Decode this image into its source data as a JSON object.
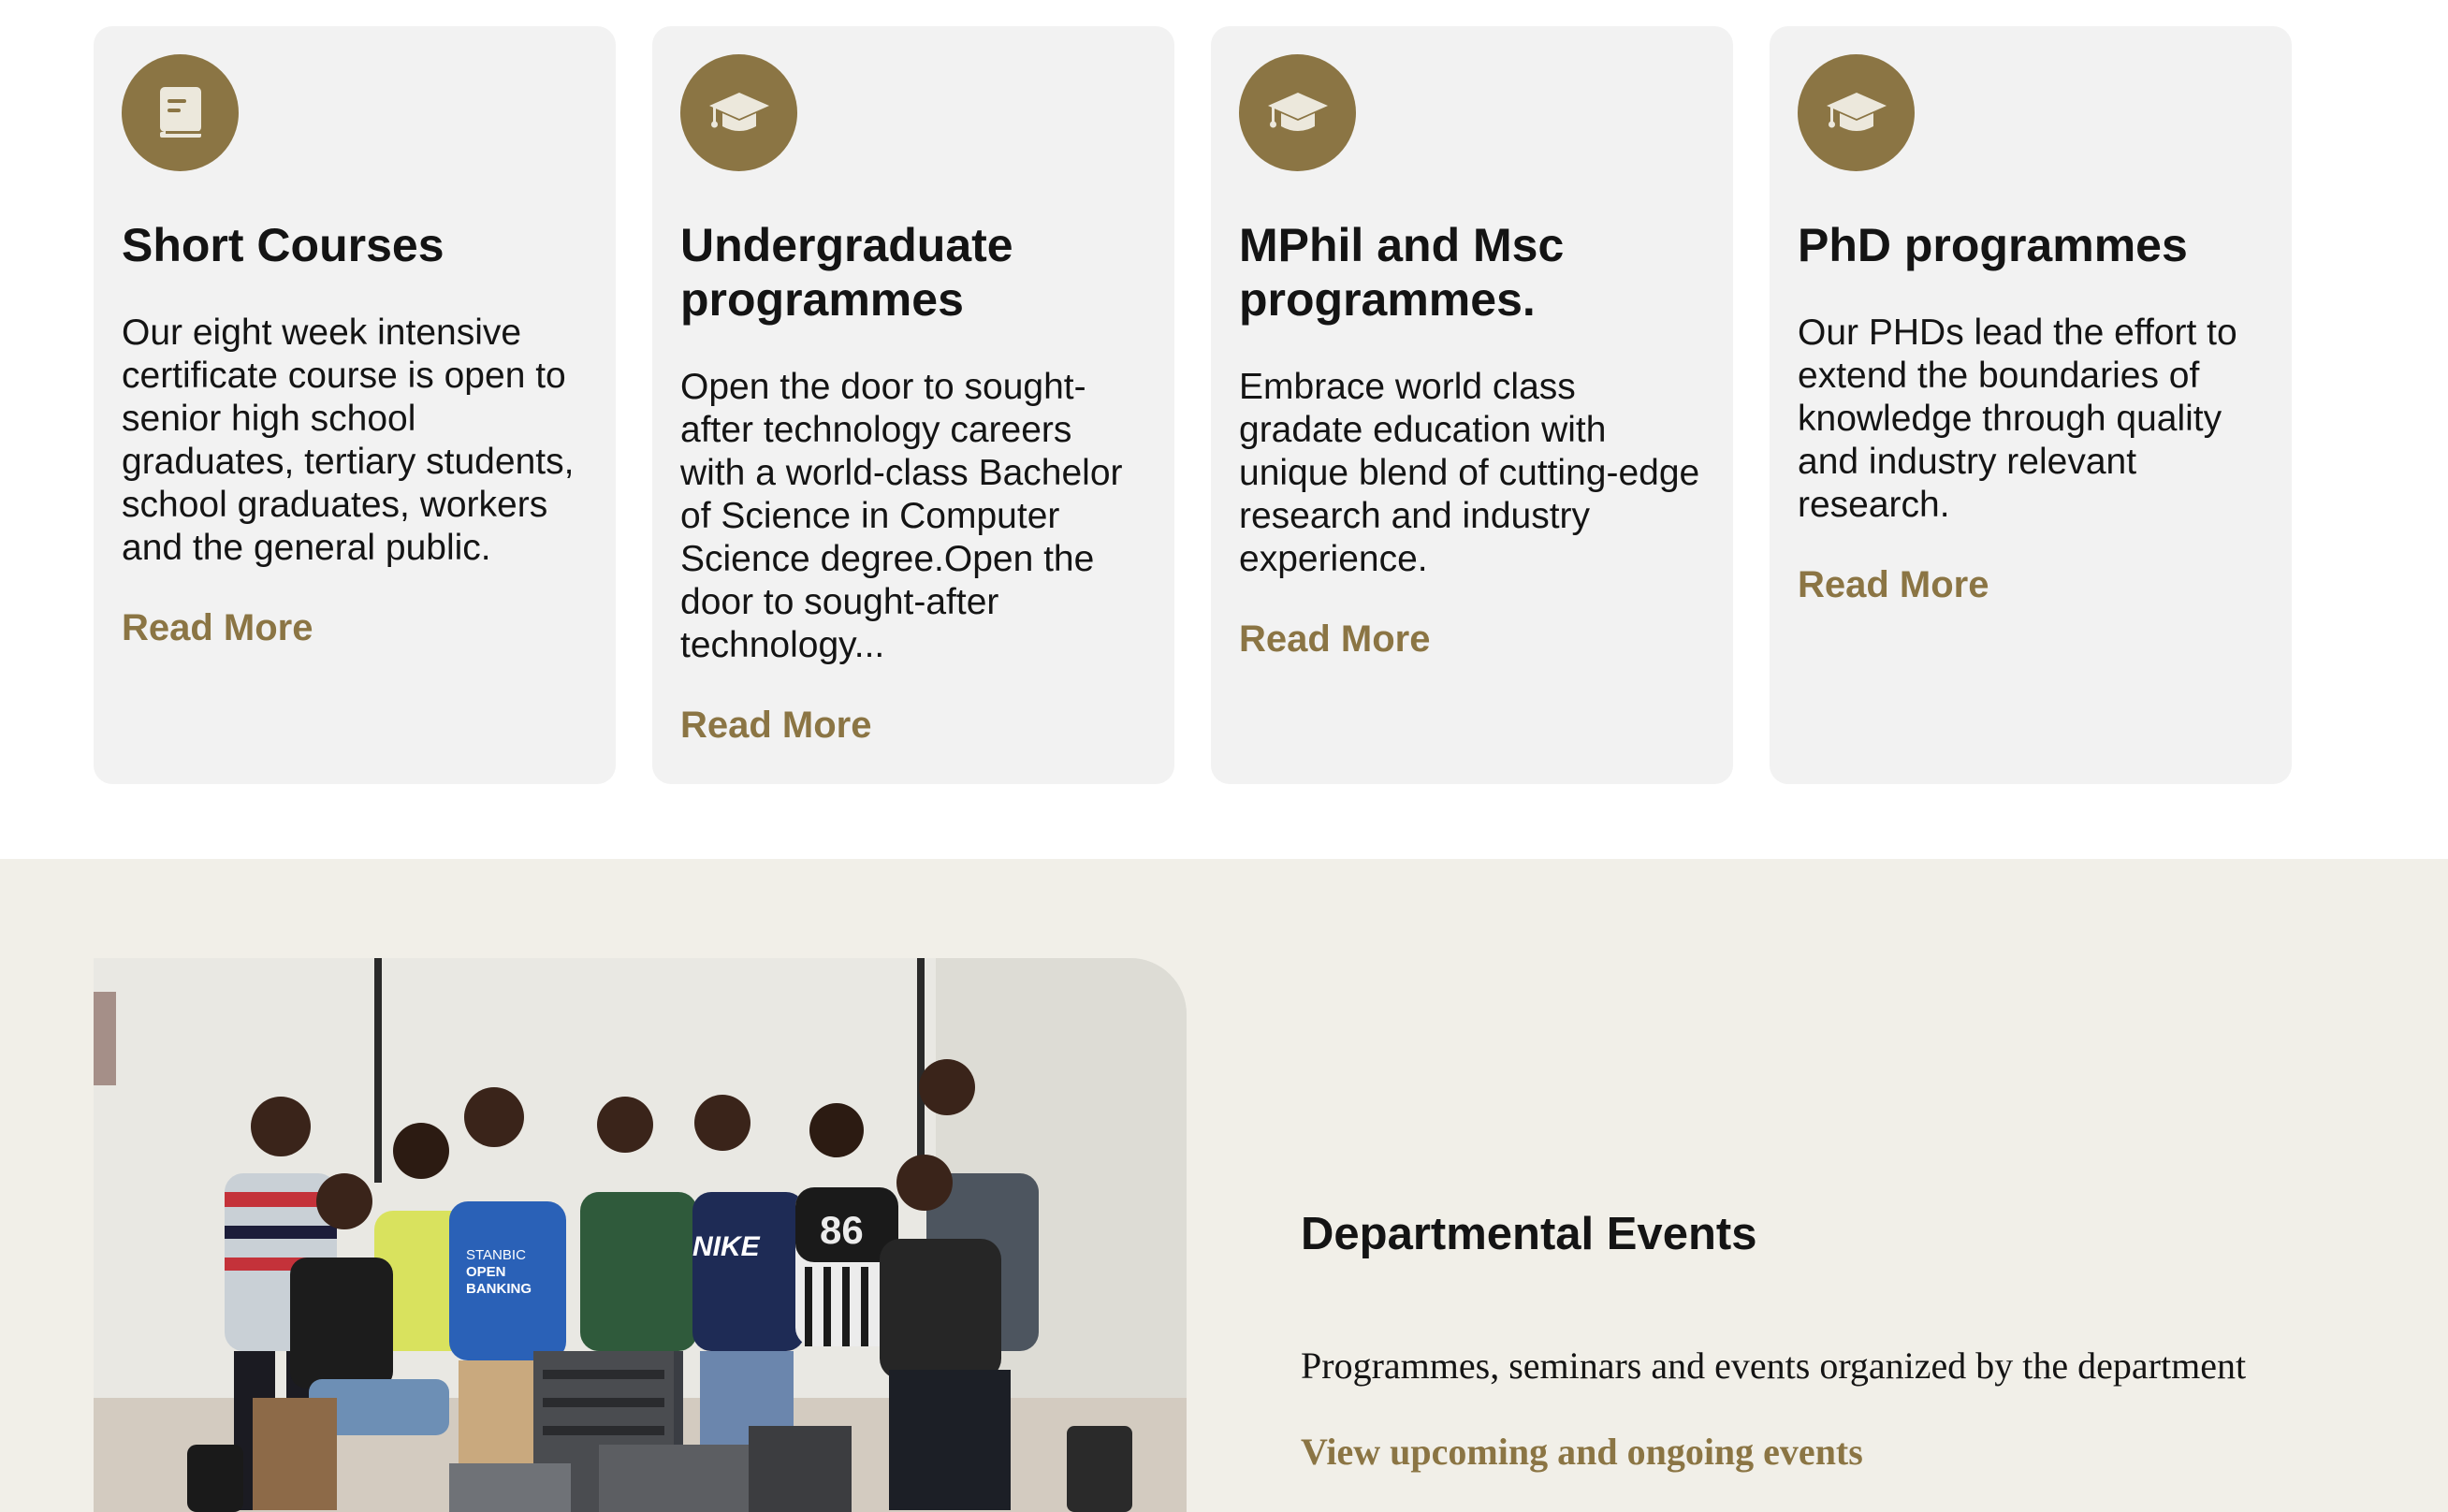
{
  "programmes": {
    "cards": [
      {
        "icon": "book-icon",
        "title": "Short Courses",
        "description": "Our eight week intensive certificate course is open to senior high school graduates, tertiary students, school graduates, workers and the general public.",
        "link": "Read More"
      },
      {
        "icon": "graduation-cap-icon",
        "title": "Undergraduate programmes",
        "description": "Open the door to sought-after technology careers with a world-class Bachelor of Science in Computer Science degree.Open the door to sought-after technology...",
        "link": "Read More"
      },
      {
        "icon": "graduation-cap-icon",
        "title": "MPhil and Msc programmes.",
        "description": "Embrace world class gradate education with unique blend of cutting-edge research and industry experience.",
        "link": "Read More"
      },
      {
        "icon": "graduation-cap-icon",
        "title": "PhD programmes",
        "description": "Our PHDs lead the effort to extend the boundaries of knowledge through quality and industry relevant research.",
        "link": "Read More"
      }
    ]
  },
  "events": {
    "photo_text": {
      "shirt_line1": "STANBIC",
      "shirt_line2": "OPEN",
      "shirt_line3": "BANKING",
      "brand": "NIKE",
      "jersey_number": "86"
    },
    "title": "Departmental Events",
    "description": "Programmes, seminars and events organized by the department",
    "link": "View upcoming and ongoing events"
  },
  "colors": {
    "accent": "#8b7544",
    "card_background": "#f2f2f2",
    "events_background": "#f1efe8",
    "text": "#141414"
  }
}
